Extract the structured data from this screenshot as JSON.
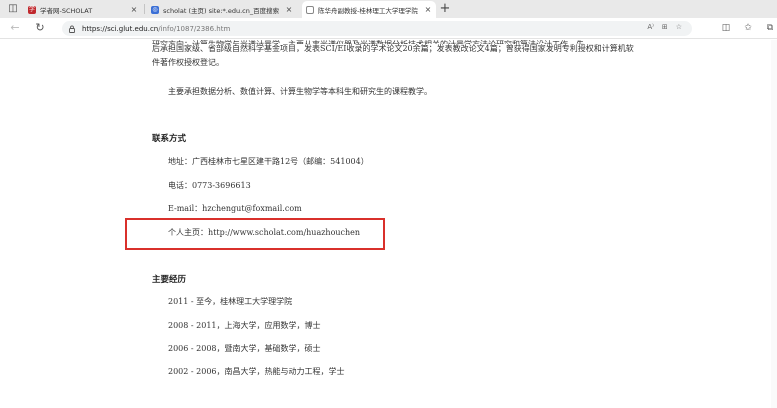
{
  "tabs": [
    {
      "title": "学者网-SCHOLAT",
      "favicon_color": "#c0282d",
      "favicon_glyph": "学",
      "active": false
    },
    {
      "title": "scholat (主页) site:*.edu.cn_百度搜索",
      "favicon_color": "#3b6fd6",
      "favicon_glyph": "◎",
      "active": false
    },
    {
      "title": "陈华舟副教授-桂林理工大学理学院",
      "favicon_color": "#888888",
      "favicon_glyph": "▯",
      "active": true
    }
  ],
  "toolbar": {
    "url_host": "https://sci.glut.edu.cn",
    "url_path": "/info/1087/2386.htm",
    "read_aloud": "A⁾"
  },
  "content": {
    "clipped_top_line": "研究方向：计算生物学与光谱计量学。主要从事光谱仪器及光谱数据分析技术相关的计量学方法论研究和算法设计工作。先",
    "para1_line1": "后承担国家级、省部级自然科学基金项目，发表SCI/EI收录的学术论文20余篇；发表教改论文4篇；曾获得国家发明专利授权和计算机软",
    "para1_line2": "件著作权授权登记。",
    "para2": "主要承担数据分析、数值计算、计算生物学等本科生和研究生的课程教学。",
    "contact_heading": "联系方式",
    "address": "地址：广西桂林市七星区建干路12号（邮编：541004）",
    "phone": "电话：0773-3696613",
    "email": "E-mail：hzchengut@foxmail.com",
    "homepage": "个人主页：http://www.scholat.com/huazhouchen",
    "experience_heading": "主要经历",
    "experience": [
      "2011 - 至今，桂林理工大学理学院",
      "2008 - 2011，上海大学，应用数学，博士",
      "2006 - 2008，暨南大学，基础数学，硕士",
      "2002 - 2006，南昌大学，热能与动力工程，学士"
    ]
  },
  "colors": {
    "highlight": "#d9302b"
  }
}
